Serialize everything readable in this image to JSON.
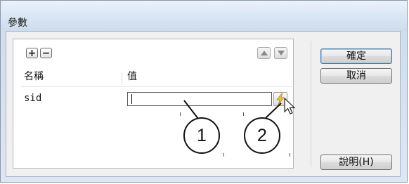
{
  "window": {
    "title": "參數"
  },
  "toolbar": {
    "add_symbol": "+",
    "remove_symbol": "−"
  },
  "grid": {
    "columns": [
      "名稱",
      "值"
    ],
    "rows": [
      {
        "name": "sid",
        "value": ""
      }
    ]
  },
  "buttons": {
    "ok": "確定",
    "cancel": "取消",
    "help": "說明(H)"
  },
  "callouts": [
    "1",
    "2"
  ],
  "colors": {
    "bolt": "#f2c12e",
    "default_button_border": "#3c7fb1"
  }
}
